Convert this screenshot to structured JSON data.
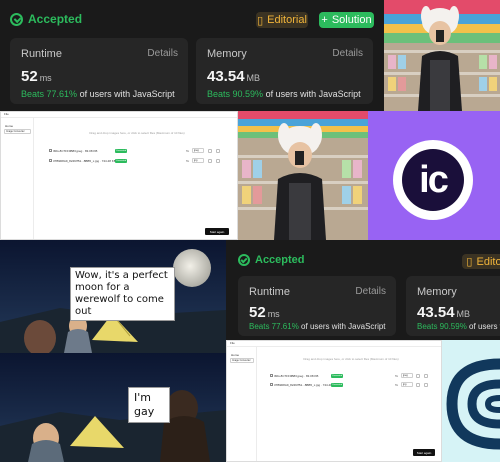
{
  "result_panel_top": {
    "status": "Accepted",
    "editorial_label": "Editorial",
    "solution_label": "Solution",
    "runtime": {
      "title": "Runtime",
      "details": "Details",
      "value": "52",
      "unit": "ms",
      "beats_pct": "Beats 77.61%",
      "beats_rest": "of users with JavaScript"
    },
    "memory": {
      "title": "Memory",
      "details": "Details",
      "value": "43.54",
      "unit": "MB",
      "beats_pct": "Beats 90.59%",
      "beats_rest": "of users with JavaScript"
    }
  },
  "result_panel_bottom": {
    "status": "Accepted",
    "editorial_label": "Edito",
    "runtime": {
      "title": "Runtime",
      "details": "Details",
      "value": "52",
      "unit": "ms",
      "beats_pct": "Beats 77.61%",
      "beats_rest": "of users with JavaScript"
    },
    "memory": {
      "title": "Memory",
      "value": "43.54",
      "unit": "MB",
      "beats_pct": "Beats 90.59%",
      "beats_rest": "of users with"
    }
  },
  "upload_app_top": {
    "app_name": "File",
    "sidebar_title": "Home",
    "sidebar_item": "Image Converter",
    "drop_hint": "Drag and drop images here, or click to select files (Maximum of 10 files)",
    "files": [
      {
        "name": "IMG-8C7FF0B83.jpeg · 83.08 KB",
        "status": "Converted",
        "to": "To",
        "format": "jpeg"
      },
      {
        "name": "37B9D8A9_82497B1...8BB5_x.jpg · 744.48 KB",
        "status": "Converted",
        "to": "To",
        "format": "jpg"
      }
    ],
    "start_label": "Start again"
  },
  "upload_app_bottom": {
    "app_name": "File",
    "sidebar_title": "Home",
    "sidebar_item": "Image Converter",
    "drop_hint": "Drag and drop images here, or click to select files (Maximum of 10 files)",
    "files": [
      {
        "name": "IMG-8C7FF0B83.jpeg · 83.08 KB",
        "status": "Converted",
        "to": "To",
        "format": "jpeg"
      },
      {
        "name": "37B9D8A9_82497B1...8BB5_x.jpg · 744.48 KB",
        "status": "Converted",
        "to": "To",
        "format": "jpg"
      }
    ],
    "start_label": "Start again"
  },
  "ic_logo": {
    "text": "ic",
    "bg_color": "#9863f3"
  },
  "meme": {
    "caption_top": "Wow, it's a perfect moon for a werewolf to come out",
    "caption_bottom": "I'm gay"
  },
  "colors": {
    "accent_green": "#2cbb5d",
    "editorial_gold": "#f0b43a",
    "panel_bg": "#1a1a1a",
    "card_bg": "#262626"
  }
}
